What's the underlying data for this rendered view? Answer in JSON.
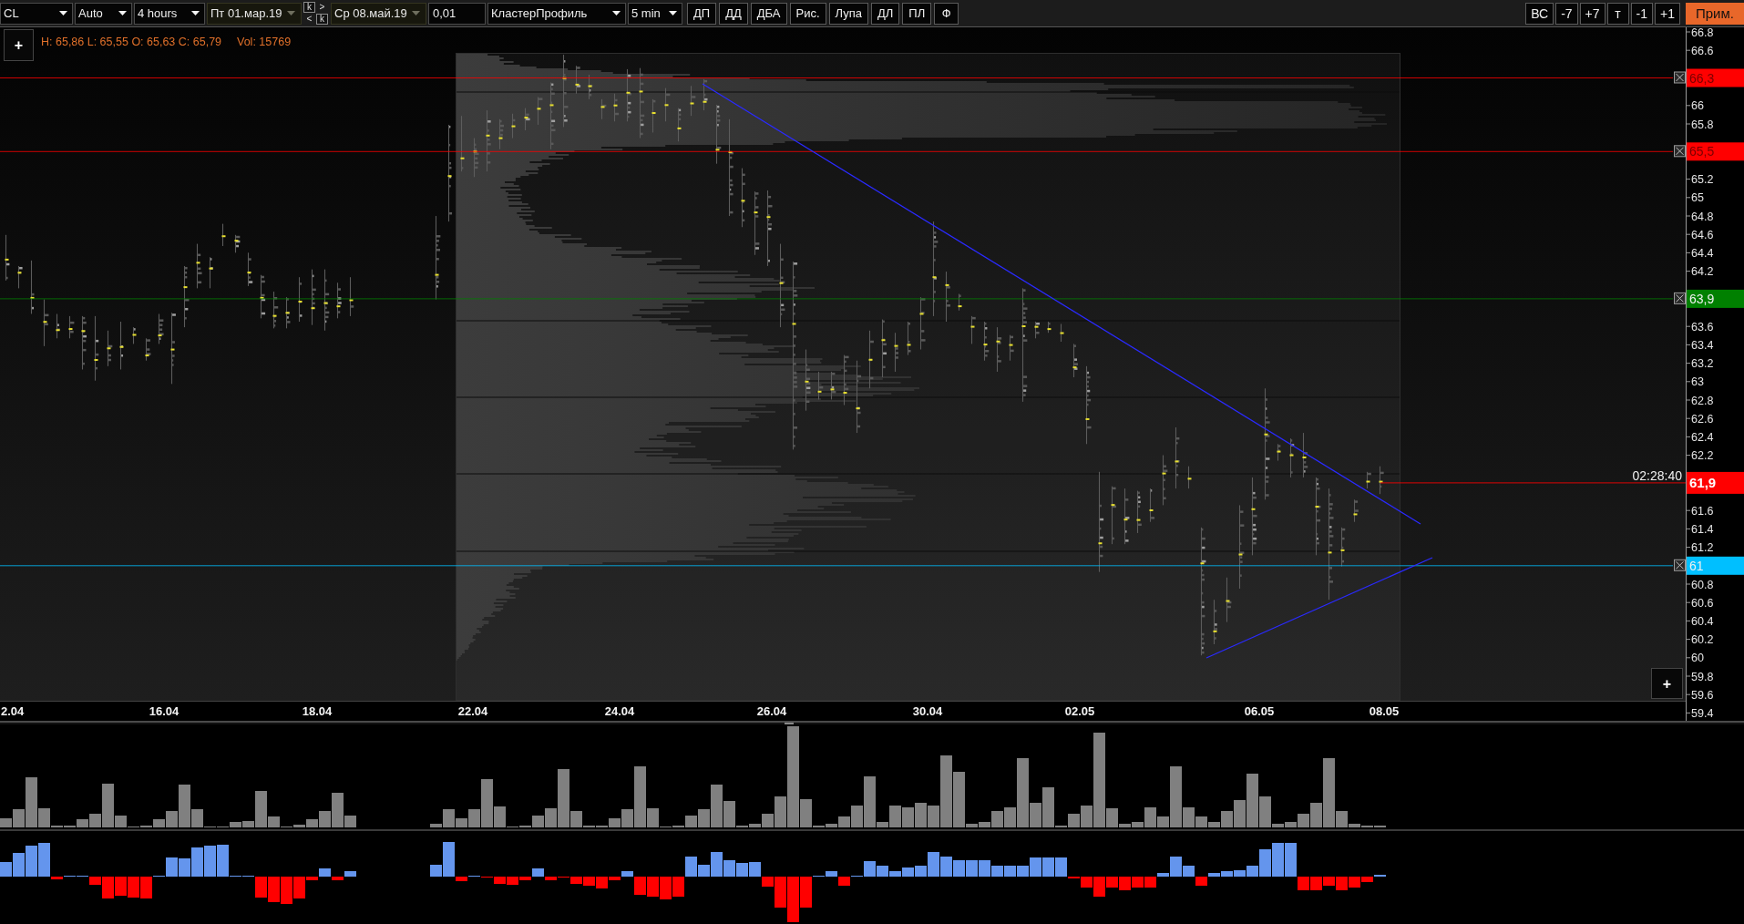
{
  "toolbar": {
    "symbol": "CL",
    "scale": "Auto",
    "timeframe": "4 hours",
    "start_date": "Пт 01.мар.19",
    "date_steppers": [
      {
        "label": "k",
        "kind": "key"
      },
      {
        "label": ">",
        "kind": "arrow"
      },
      {
        "label": "<",
        "kind": "arrow"
      },
      {
        "label": "k",
        "kind": "key"
      }
    ],
    "end_date": "Ср 08.май.19",
    "tick_size": "0,01",
    "template": "КластерПрофиль",
    "cluster_period": "5 min",
    "tool_buttons": [
      "ДП",
      "ДД",
      "ДБА",
      "Рис.",
      "Лупа",
      "ДЛ",
      "ПЛ",
      "Ф"
    ],
    "nav_buttons": [
      "ВС",
      "-7",
      "+7",
      "т",
      "-1",
      "+1"
    ],
    "apply_button": "Прим."
  },
  "chart": {
    "ohlc": "H: 65,86 L: 65,55 O: 65,63 C: 65,79",
    "volume": "Vol: 15769",
    "top_button": "+",
    "price_ticks": [
      "66.8",
      "66.6",
      "66",
      "65.8",
      "65.2",
      "65",
      "64.8",
      "64.6",
      "64.4",
      "64.2",
      "63.6",
      "63.4",
      "63.2",
      "63",
      "62.8",
      "62.6",
      "62.4",
      "62.2",
      "61.6",
      "61.4",
      "61.2",
      "60.8",
      "60.6",
      "60.4",
      "60.2",
      "60",
      "59.8",
      "59.6",
      "59.4"
    ],
    "levels": [
      {
        "kind": "alert",
        "label": "66,3",
        "color": "#ff0000"
      },
      {
        "kind": "alert",
        "label": "65,5",
        "color": "#ff0000"
      },
      {
        "kind": "alert",
        "label": "63,9",
        "color": "#008000"
      },
      {
        "kind": "last",
        "label": "61,9",
        "color": "#ff0000"
      },
      {
        "kind": "alert",
        "label": "61",
        "color": "#00bfff"
      }
    ],
    "timer": "02:28:40",
    "dates": [
      "2.04",
      "16.04",
      "18.04",
      "22.04",
      "24.04",
      "26.04",
      "30.04",
      "02.05",
      "06.05",
      "08.05"
    ],
    "bottom_button": "+"
  }
}
